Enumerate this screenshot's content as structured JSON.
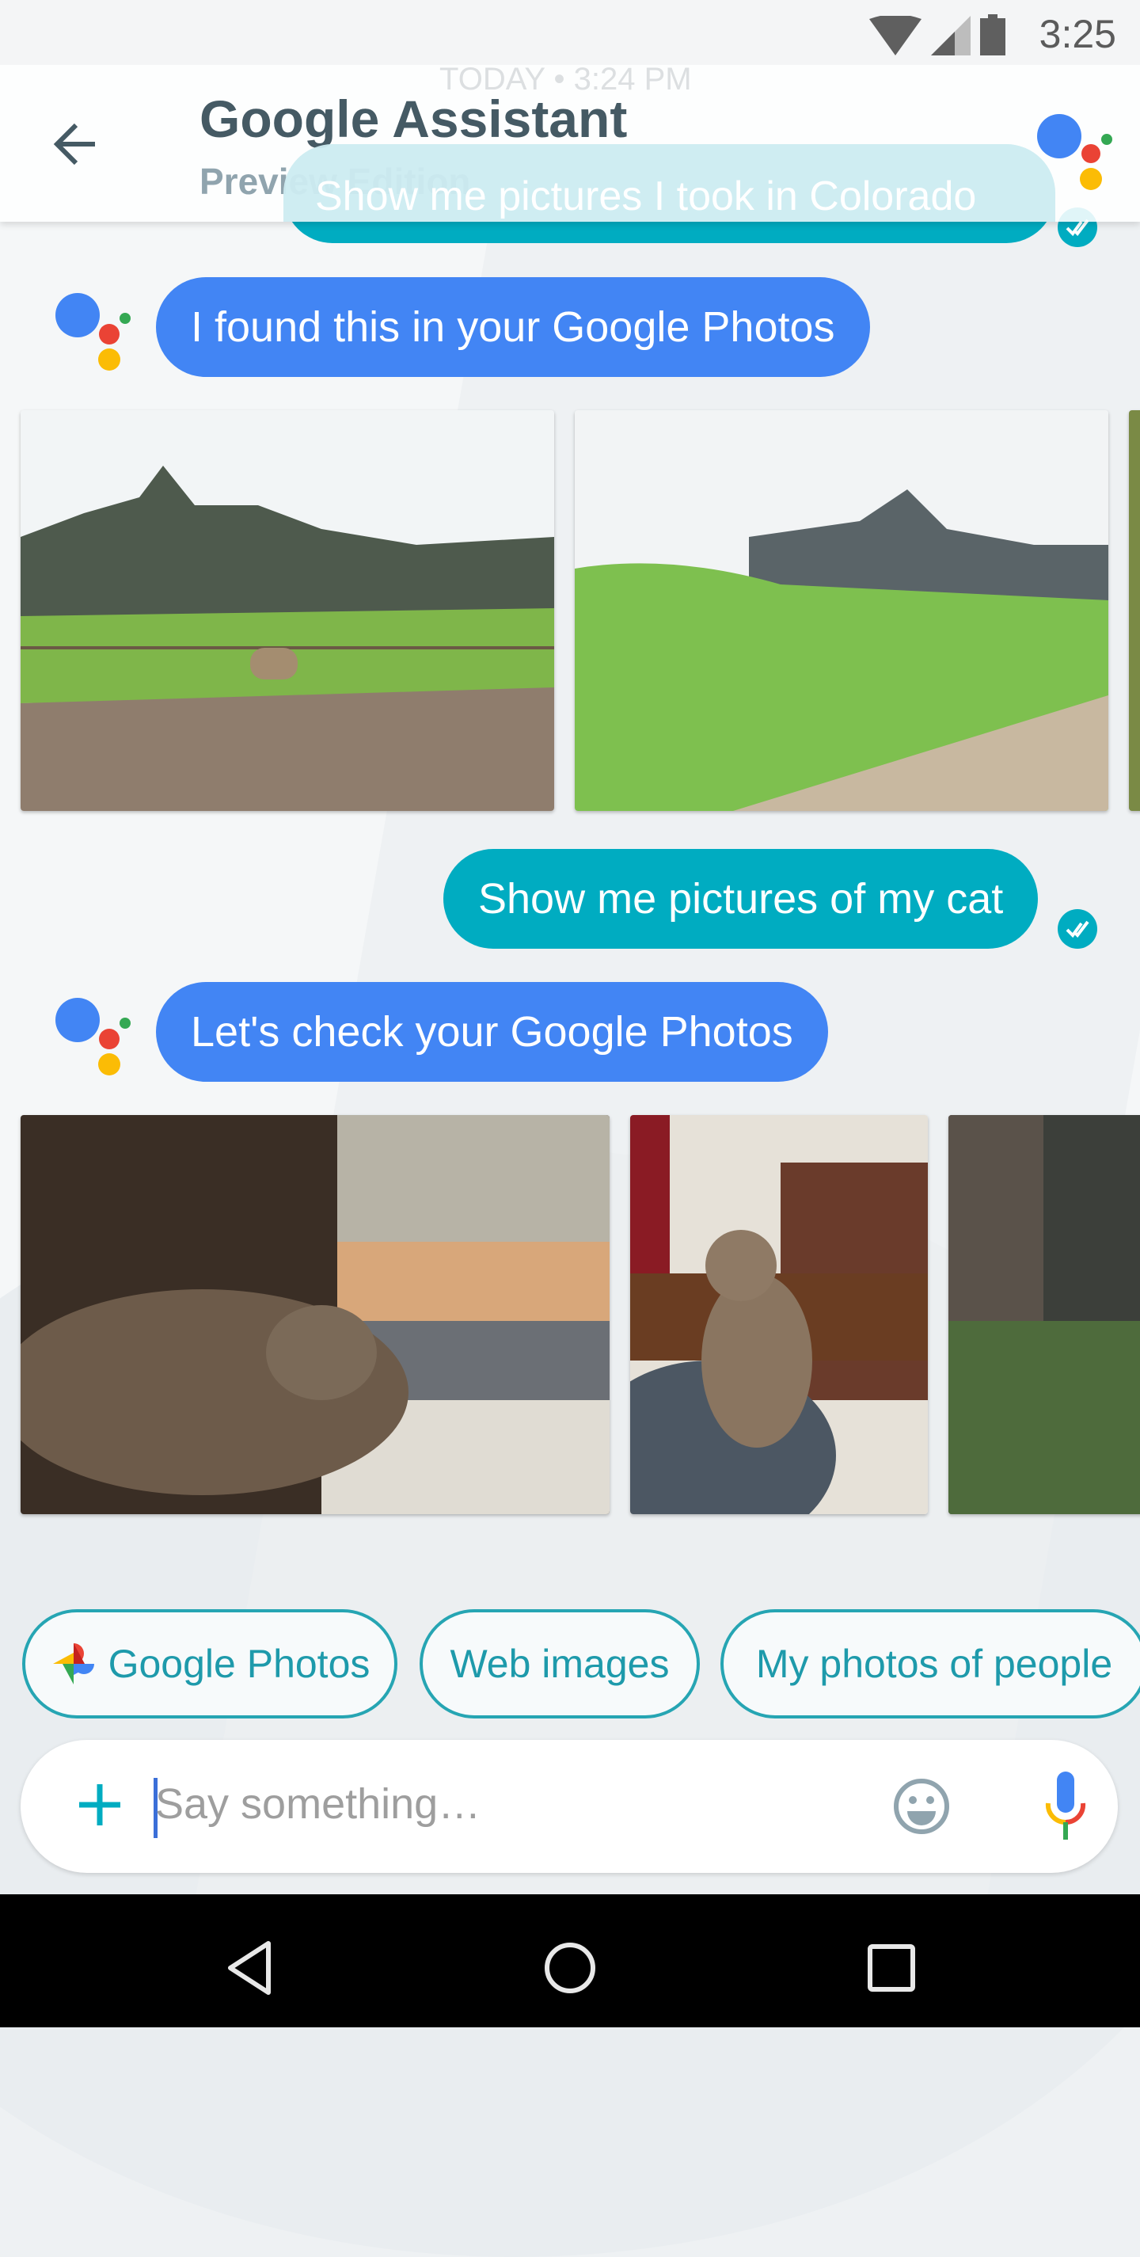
{
  "status_bar": {
    "time": "3:25",
    "icons": [
      "wifi-icon",
      "signal-icon",
      "battery-icon"
    ]
  },
  "header": {
    "title": "Google Assistant",
    "subtitle": "Preview Edition",
    "timestamp": "TODAY • 3:24 PM",
    "back_icon": "arrow-left-icon",
    "logo_icon": "google-assistant-logo"
  },
  "messages": [
    {
      "sender": "user",
      "text": "Show me pictures I took in Colorado",
      "status": "delivered"
    },
    {
      "sender": "assistant",
      "text": "I found this in your Google Photos"
    },
    {
      "sender": "user",
      "text": "Show me pictures of my cat",
      "status": "delivered"
    },
    {
      "sender": "assistant",
      "text": "Let's check your Google Photos"
    }
  ],
  "photo_rows": [
    {
      "description": [
        "Flatirons mountains with fence and dirt lot",
        "Flatirons mountains with green meadow and trail",
        "partially visible photo"
      ]
    },
    {
      "description": [
        "Cat sleeping by window at sunset",
        "Cat sitting on couch with red collar",
        "partially visible photo of tree"
      ]
    }
  ],
  "suggestion_chips": [
    {
      "label": "Google Photos",
      "icon": "google-photos-pinwheel-icon"
    },
    {
      "label": "Web images"
    },
    {
      "label": "My photos of people"
    }
  ],
  "input": {
    "placeholder": "Say something…",
    "value": ""
  },
  "colors": {
    "assistant_bubble": "#4285f4",
    "user_bubble": "#00acc1",
    "chip_border": "#26a5b3"
  },
  "nav_bar": {
    "buttons": [
      "back",
      "home",
      "recents"
    ]
  }
}
